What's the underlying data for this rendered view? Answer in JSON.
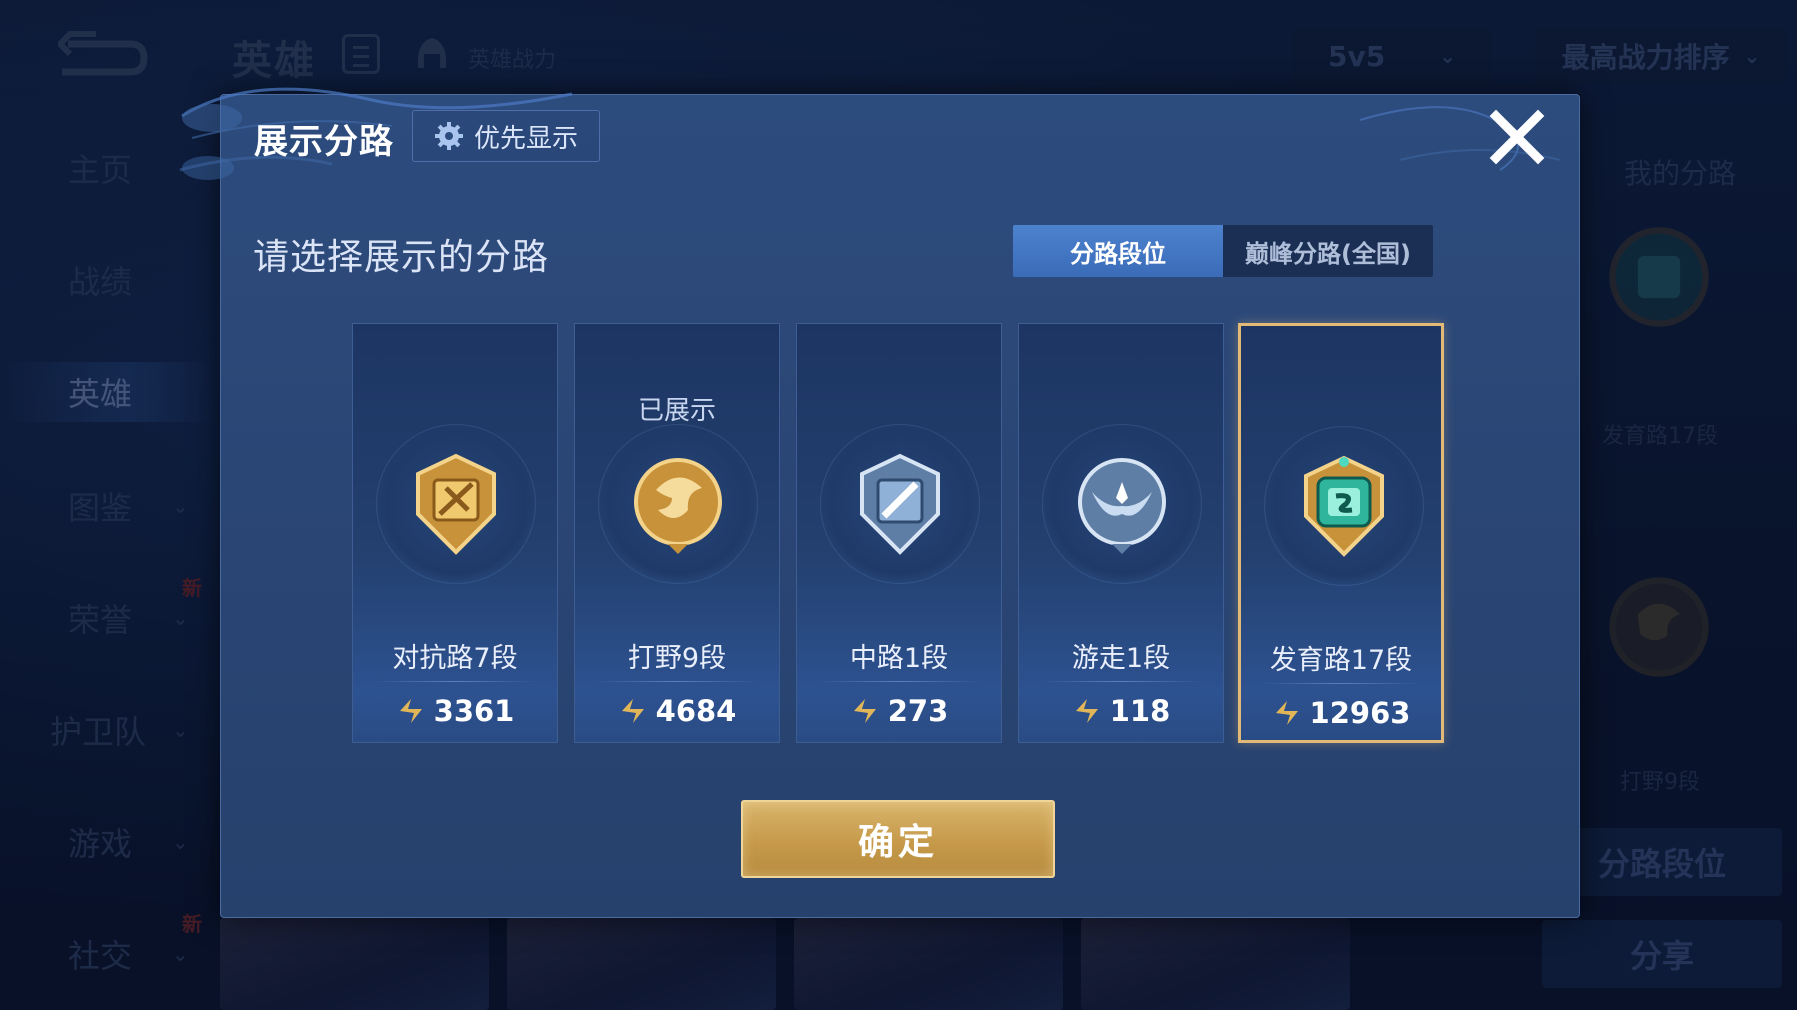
{
  "header": {
    "title": "英雄",
    "hero_power_label": "英雄战力",
    "mode_select": "5v5",
    "sort_select": "最高战力排序"
  },
  "sidebar": {
    "items": [
      {
        "label": "主页"
      },
      {
        "label": "战绩"
      },
      {
        "label": "英雄"
      },
      {
        "label": "图鉴"
      },
      {
        "label": "荣誉",
        "badge": "新"
      },
      {
        "label": "护卫队"
      },
      {
        "label": "游戏"
      },
      {
        "label": "社交",
        "badge": "新"
      }
    ]
  },
  "right_panel": {
    "title": "我的分路",
    "items": [
      {
        "label": "发育路17段"
      },
      {
        "label": "打野9段"
      }
    ],
    "lane_rank_button": "分路段位",
    "share_button": "分享"
  },
  "dialog": {
    "title": "展示分路",
    "priority_button": "优先显示",
    "subtitle": "请选择展示的分路",
    "tabs": [
      {
        "label": "分路段位",
        "active": true
      },
      {
        "label": "巅峰分路(全国)",
        "active": false
      }
    ],
    "cards": [
      {
        "rank": "对抗路7段",
        "score": "3361",
        "shown": "",
        "selected": false,
        "emblem": "sword-emblem-icon",
        "color": "#d9a441"
      },
      {
        "rank": "打野9段",
        "score": "4684",
        "shown": "已展示",
        "selected": false,
        "emblem": "dragon-emblem-icon",
        "color": "#d9a441"
      },
      {
        "rank": "中路1段",
        "score": "273",
        "shown": "",
        "selected": false,
        "emblem": "mid-lane-emblem-icon",
        "color": "#a9c1dc"
      },
      {
        "rank": "游走1段",
        "score": "118",
        "shown": "",
        "selected": false,
        "emblem": "wing-emblem-icon",
        "color": "#a9c1dc"
      },
      {
        "rank": "发育路17段",
        "score": "12963",
        "shown": "",
        "selected": true,
        "emblem": "marksman-emblem-icon",
        "color": "#35c2a8"
      }
    ],
    "confirm_button": "确定"
  },
  "colors": {
    "accent_blue": "#3a6cb8",
    "gold": "#c69a4a",
    "selected_border": "#e3b978"
  }
}
